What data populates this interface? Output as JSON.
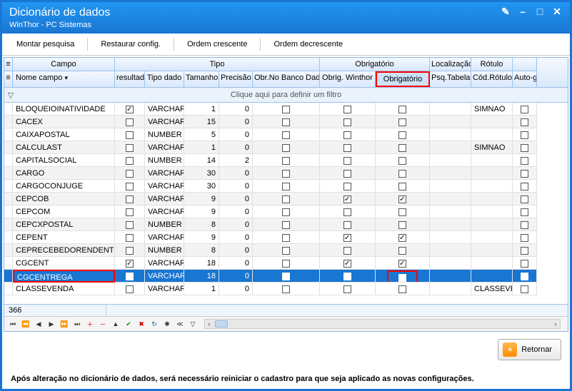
{
  "title": "Dicionário de dados",
  "subtitle": "WinThor - PC Sistemas",
  "toolbar": {
    "montar": "Montar pesquisa",
    "restaurar": "Restaurar config.",
    "ordem_cresc": "Ordem crescente",
    "ordem_decresc": "Ordem decrescente"
  },
  "headers": {
    "groups": {
      "campo": "Campo",
      "tipo": "Tipo",
      "obrigatorio": "Obrigatório",
      "localizacao": "Localização",
      "rotulo": "Rótulo"
    },
    "cols": {
      "nome_campo": "Nome campo",
      "resultado": "resultad",
      "tipo_dado": "Tipo dado",
      "tamanho": "Tamanho",
      "precisao": "Precisão",
      "obr_banco": "Obr.No Banco Dados",
      "obrig_winthor": "Obrig. Winthor",
      "obrigatorio": "Obrigatório",
      "psq_tabela": "Psq.Tabela",
      "cod_rotulo": "Cód.Rótulo",
      "autog": "Auto-g"
    }
  },
  "filter_hint": "Clique aqui para definir um filtro",
  "rows": [
    {
      "nome": "BLOQUEIOINATIVIDADE",
      "res": true,
      "tipo": "VARCHAR",
      "tam": "1",
      "prec": "0",
      "obd": false,
      "owt": false,
      "obr": false,
      "psq": "",
      "rot": "SIMNAO",
      "auto": false
    },
    {
      "nome": "CACEX",
      "res": false,
      "tipo": "VARCHAR",
      "tam": "15",
      "prec": "0",
      "obd": false,
      "owt": false,
      "obr": false,
      "psq": "",
      "rot": "",
      "auto": false
    },
    {
      "nome": "CAIXAPOSTAL",
      "res": false,
      "tipo": "NUMBER",
      "tam": "5",
      "prec": "0",
      "obd": false,
      "owt": false,
      "obr": false,
      "psq": "",
      "rot": "",
      "auto": false
    },
    {
      "nome": "CALCULAST",
      "res": false,
      "tipo": "VARCHAR",
      "tam": "1",
      "prec": "0",
      "obd": false,
      "owt": false,
      "obr": false,
      "psq": "",
      "rot": "SIMNAO",
      "auto": false
    },
    {
      "nome": "CAPITALSOCIAL",
      "res": false,
      "tipo": "NUMBER",
      "tam": "14",
      "prec": "2",
      "obd": false,
      "owt": false,
      "obr": false,
      "psq": "",
      "rot": "",
      "auto": false
    },
    {
      "nome": "CARGO",
      "res": false,
      "tipo": "VARCHAR",
      "tam": "30",
      "prec": "0",
      "obd": false,
      "owt": false,
      "obr": false,
      "psq": "",
      "rot": "",
      "auto": false
    },
    {
      "nome": "CARGOCONJUGE",
      "res": false,
      "tipo": "VARCHAR",
      "tam": "30",
      "prec": "0",
      "obd": false,
      "owt": false,
      "obr": false,
      "psq": "",
      "rot": "",
      "auto": false
    },
    {
      "nome": "CEPCOB",
      "res": false,
      "tipo": "VARCHAR",
      "tam": "9",
      "prec": "0",
      "obd": false,
      "owt": true,
      "obr": true,
      "psq": "",
      "rot": "",
      "auto": false
    },
    {
      "nome": "CEPCOM",
      "res": false,
      "tipo": "VARCHAR",
      "tam": "9",
      "prec": "0",
      "obd": false,
      "owt": false,
      "obr": false,
      "psq": "",
      "rot": "",
      "auto": false
    },
    {
      "nome": "CEPCXPOSTAL",
      "res": false,
      "tipo": "NUMBER",
      "tam": "8",
      "prec": "0",
      "obd": false,
      "owt": false,
      "obr": false,
      "psq": "",
      "rot": "",
      "auto": false
    },
    {
      "nome": "CEPENT",
      "res": false,
      "tipo": "VARCHAR",
      "tam": "9",
      "prec": "0",
      "obd": false,
      "owt": true,
      "obr": true,
      "psq": "",
      "rot": "",
      "auto": false
    },
    {
      "nome": "CEPRECEBEDORENDENT",
      "res": false,
      "tipo": "NUMBER",
      "tam": "8",
      "prec": "0",
      "obd": false,
      "owt": false,
      "obr": false,
      "psq": "",
      "rot": "",
      "auto": false
    },
    {
      "nome": "CGCENT",
      "res": true,
      "tipo": "VARCHAR",
      "tam": "18",
      "prec": "0",
      "obd": false,
      "owt": true,
      "obr": true,
      "psq": "",
      "rot": "",
      "auto": false
    },
    {
      "nome": "CGCENTREGA",
      "res": false,
      "tipo": "VARCHAR",
      "tam": "18",
      "prec": "0",
      "obd": false,
      "owt": false,
      "obr": false,
      "psq": "",
      "rot": "",
      "auto": false,
      "selected": true,
      "redNome": true,
      "redObr": true
    },
    {
      "nome": "CLASSEVENDA",
      "res": false,
      "tipo": "VARCHAR",
      "tam": "1",
      "prec": "0",
      "obd": false,
      "owt": false,
      "obr": false,
      "psq": "",
      "rot": "CLASSEVEN",
      "auto": false
    }
  ],
  "record_count": "366",
  "return_label": "Retornar",
  "warning": "Após alteração no dicionário de dados, será necessário reiniciar o cadastro para que seja aplicado as novas configurações."
}
